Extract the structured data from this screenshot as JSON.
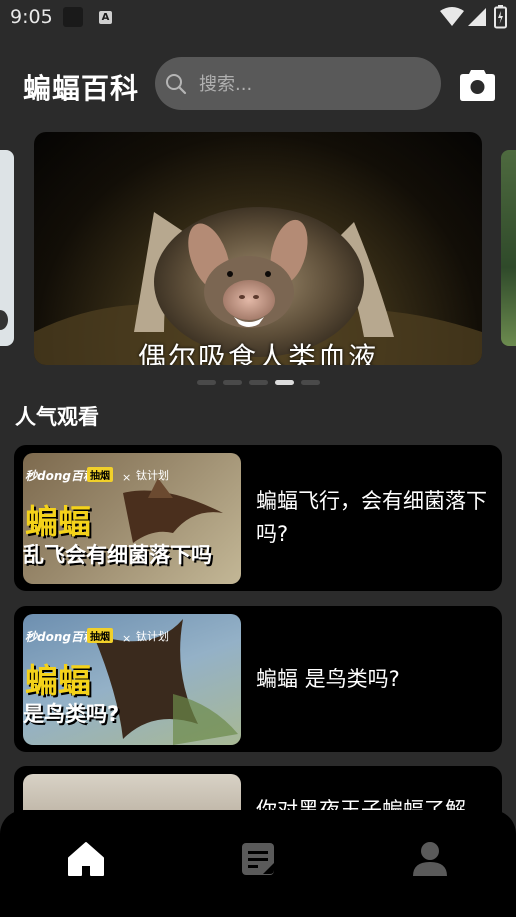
{
  "status_bar": {
    "time": "9:05",
    "notif_icon_letter": "A"
  },
  "header": {
    "title": "蝙蝠百科",
    "search_placeholder": "搜索...",
    "search_value": "",
    "icons": [
      "search-icon",
      "camera-icon"
    ]
  },
  "carousel": {
    "caption": "偶尔吸食人类血液",
    "page_count": 5,
    "active_index": 3
  },
  "section": {
    "title": "人气观看"
  },
  "videos": [
    {
      "title": "蝙蝠飞行，会有细菌落下吗?",
      "thumb_logo": "秒dong百科",
      "thumb_badge": "抽烟",
      "thumb_x": "×",
      "thumb_partner": "钛计划",
      "thumb_big": "蝙蝠",
      "thumb_sub": "乱飞会有细菌落下吗"
    },
    {
      "title": "蝙蝠 是鸟类吗?",
      "thumb_logo": "秒dong百科",
      "thumb_badge": "抽烟",
      "thumb_x": "×",
      "thumb_partner": "钛计划",
      "thumb_big": "蝙蝠",
      "thumb_sub": "是鸟类吗?"
    },
    {
      "title": "你对黑夜王子蝙蝠了解"
    }
  ],
  "bottom_nav": {
    "items": [
      "home-icon",
      "notes-icon",
      "profile-icon"
    ],
    "active_index": 0
  },
  "colors": {
    "background": "#2b2b2b",
    "card": "#000000",
    "search_bg": "#595959",
    "dot_active": "#dddddd",
    "dot_inactive": "#4a4a4a"
  }
}
